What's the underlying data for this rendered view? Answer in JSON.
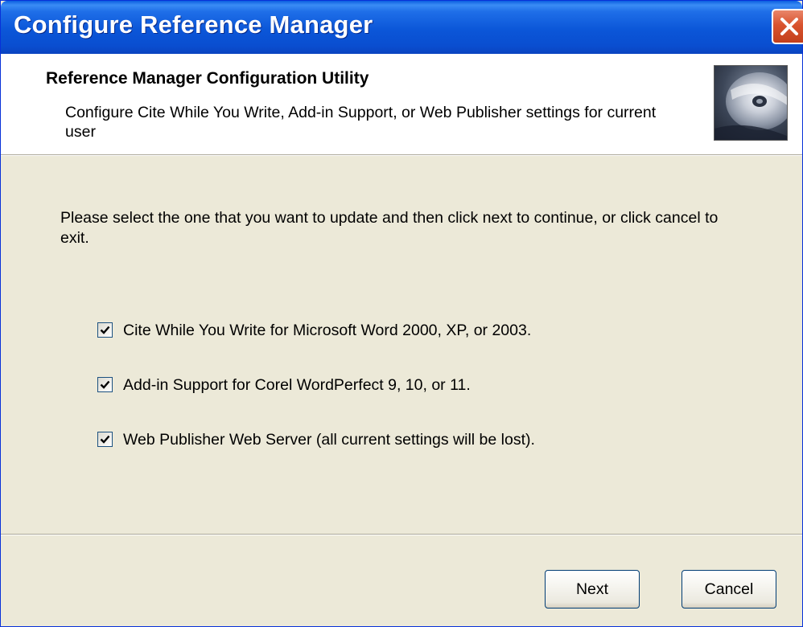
{
  "window": {
    "title": "Configure Reference Manager"
  },
  "header": {
    "title": "Reference Manager Configuration Utility",
    "subtitle": "Configure Cite While You Write, Add-in Support, or Web Publisher settings for current user",
    "image_icon": "cd-disc-icon"
  },
  "body": {
    "instruction": "Please select the one that you want to update and then click next to continue, or click cancel to exit.",
    "options": [
      {
        "label": "Cite While You Write for Microsoft Word 2000, XP, or 2003.",
        "checked": true
      },
      {
        "label": "Add-in Support for Corel WordPerfect 9, 10, or 11.",
        "checked": true
      },
      {
        "label": "Web Publisher Web Server (all current settings will be lost).",
        "checked": true
      }
    ]
  },
  "buttons": {
    "next": "Next",
    "cancel": "Cancel"
  },
  "colors": {
    "titlebar": "#0b56d8",
    "dialog_background": "#ece9d8",
    "close_button": "#d9532e"
  }
}
